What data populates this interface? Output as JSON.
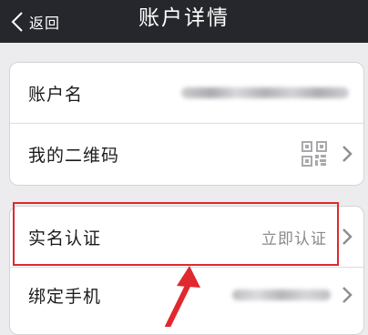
{
  "navbar": {
    "back_label": "返回",
    "title": "账户详情"
  },
  "rows": {
    "account_name": "账户名",
    "qr_code": "我的二维码",
    "real_name": "实名认证",
    "real_name_status": "立即认证",
    "bind_phone": "绑定手机"
  },
  "icons": {
    "back": "chevron-left-icon",
    "qr": "qr-code-icon",
    "row_arrow": "chevron-right-icon",
    "annotation": "red-arrow"
  },
  "colors": {
    "navbar_bg": "#26272c",
    "page_bg": "#ececee",
    "highlight": "#e0282e",
    "secondary_text": "#8a8a8f"
  }
}
